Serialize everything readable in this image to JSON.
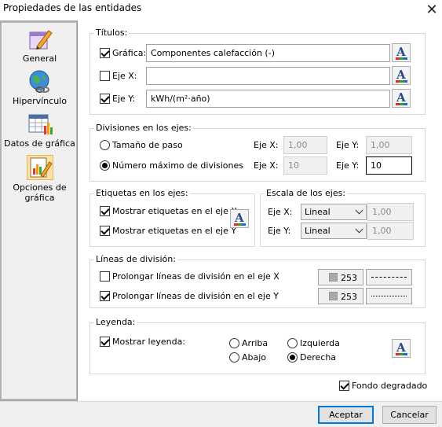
{
  "window": {
    "title": "Propiedades de las entidades"
  },
  "sidebar": {
    "items": [
      {
        "label": "General",
        "icon": "edit-pencil-icon"
      },
      {
        "label": "Hipervínculo",
        "icon": "globe-link-icon"
      },
      {
        "label": "Datos de gráfica",
        "icon": "table-chart-icon"
      },
      {
        "label": "Opciones de gráfica",
        "icon": "chart-options-icon",
        "selected": true
      }
    ]
  },
  "titulos": {
    "group_label": "Títulos:",
    "grafica": {
      "label": "Gráfica:",
      "checked": true,
      "value": "Componentes calefacción (-)"
    },
    "eje_x": {
      "label": "Eje X:",
      "checked": false,
      "value": ""
    },
    "eje_y": {
      "label": "Eje Y:",
      "checked": true,
      "value": "kWh/(m²·año)"
    }
  },
  "divisiones": {
    "group_label": "Divisiones en los ejes:",
    "tamano_paso": {
      "label": "Tamaño de paso",
      "selected": false,
      "eje_x_label": "Eje X:",
      "eje_x_value": "1,00",
      "eje_y_label": "Eje Y:",
      "eje_y_value": "1,00"
    },
    "numero_max": {
      "label": "Número máximo de divisiones",
      "selected": true,
      "eje_x_label": "Eje X:",
      "eje_x_value": "10",
      "eje_y_label": "Eje Y:",
      "eje_y_value": "10"
    }
  },
  "etiquetas": {
    "group_label": "Etiquetas en los ejes:",
    "mostrar_x": {
      "label": "Mostrar etiquetas en el eje X",
      "checked": true
    },
    "mostrar_y": {
      "label": "Mostrar etiquetas en el eje Y",
      "checked": true
    }
  },
  "escala": {
    "group_label": "Escala de los ejes:",
    "eje_x": {
      "label": "Eje X:",
      "selected": "Lineal",
      "value": "1,00"
    },
    "eje_y": {
      "label": "Eje Y:",
      "selected": "Lineal",
      "value": "1,00"
    }
  },
  "lineas": {
    "group_label": "Líneas de división:",
    "prolongar_x": {
      "label": "Prolongar líneas de división en el eje X",
      "checked": false,
      "color_value": "253",
      "line_style": "dash"
    },
    "prolongar_y": {
      "label": "Prolongar líneas de división en el eje Y",
      "checked": true,
      "color_value": "253",
      "line_style": "dotted"
    }
  },
  "leyenda": {
    "group_label": "Leyenda:",
    "mostrar": {
      "label": "Mostrar leyenda:",
      "checked": true
    },
    "positions": [
      {
        "label": "Arriba",
        "selected": false
      },
      {
        "label": "Izquierda",
        "selected": false
      },
      {
        "label": "Abajo",
        "selected": false
      },
      {
        "label": "Derecha",
        "selected": true
      }
    ]
  },
  "fondo": {
    "label": "Fondo degradado",
    "checked": true
  },
  "footer": {
    "accept_label": "Aceptar",
    "cancel_label": "Cancelar"
  },
  "colors": {
    "accent": "#0078d7",
    "sidebar_bg": "#aeaeae",
    "selected_item": "#fbe3a6"
  }
}
